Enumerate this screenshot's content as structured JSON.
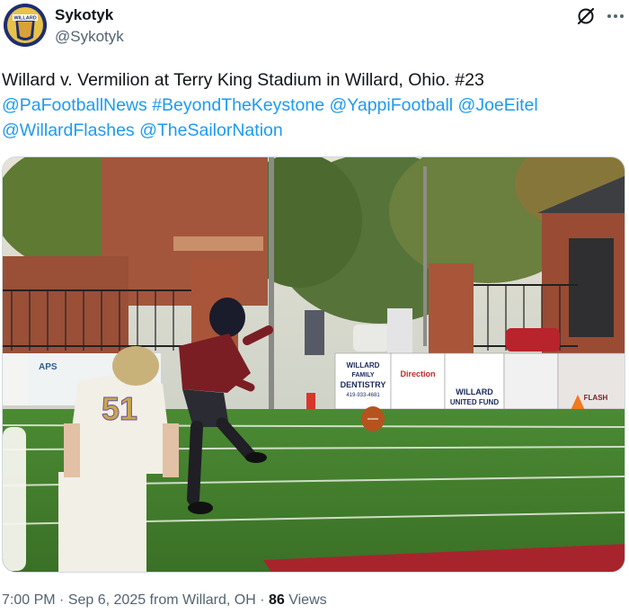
{
  "author": {
    "name": "Sykotyk",
    "handle": "@Sykotyk",
    "avatar_text": "WILLARD"
  },
  "tweet": {
    "text_line1": "Willard v. Vermilion at Terry King Stadium in Willard, Ohio. #23",
    "mentions_line2": [
      "@PaFootballNews",
      "#BeyondTheKeystone",
      "@YappiFootball",
      "@JoeEitel"
    ],
    "mentions_line3": [
      "@WillardFlashes",
      "@TheSailorNation"
    ]
  },
  "photo": {
    "jersey_number": "51",
    "signs": {
      "dentistry_top": "WILLARD",
      "dentistry_family": "FAMILY",
      "dentistry_main": "DENTISTRY",
      "dentistry_phone": "419-933-4681",
      "direction_brand": "Direction",
      "united_fund_top": "WILLARD",
      "united_fund_bottom": "UNITED FUND",
      "aps": "APS",
      "flash": "FLASH"
    }
  },
  "meta": {
    "time": "7:00 PM",
    "sep1": " · ",
    "date": "Sep 6, 2025",
    "from": " from Willard, OH",
    "sep2": " · ",
    "views_count": "86",
    "views_label": " Views"
  },
  "colors": {
    "link": "#1d9bf0",
    "secondary_text": "#536471",
    "turf": "#3f7a2c",
    "brick": "#a4563c",
    "kicker_jersey": "#7a1e24",
    "defender_jersey": "#f2efe6",
    "defender_gold": "#c9a84b"
  }
}
